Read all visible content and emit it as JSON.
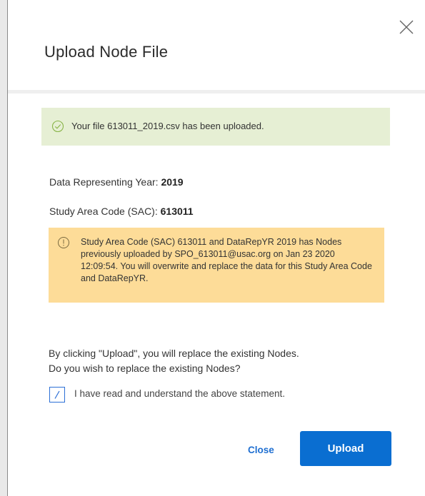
{
  "dialog": {
    "title": "Upload Node File",
    "close_icon": "close-icon"
  },
  "success": {
    "icon": "check-circle-icon",
    "message": "Your file 613011_2019.csv has been uploaded.",
    "color": "#e6efd4"
  },
  "details": {
    "year_label": "Data Representing Year: ",
    "year_value": "2019",
    "sac_label": "Study Area Code (SAC): ",
    "sac_value": "613011"
  },
  "warning": {
    "icon": "info-circle-icon",
    "color": "#fddc98",
    "text": "Study Area Code (SAC) 613011 and DataRepYR 2019 has Nodes previously uploaded by SPO_613011@usac.org on Jan 23 2020 12:09:54. You will overwrite and replace the data for this Study Area Code and DataRepYR."
  },
  "statement": {
    "line1": "By clicking \"Upload\", you will replace the existing Nodes.",
    "line2": "Do you wish to replace the existing Nodes?"
  },
  "acknowledge": {
    "checked": true,
    "label": "I have read and understand the above statement."
  },
  "actions": {
    "close_label": "Close",
    "upload_label": "Upload",
    "accent": "#0a6ed1"
  }
}
